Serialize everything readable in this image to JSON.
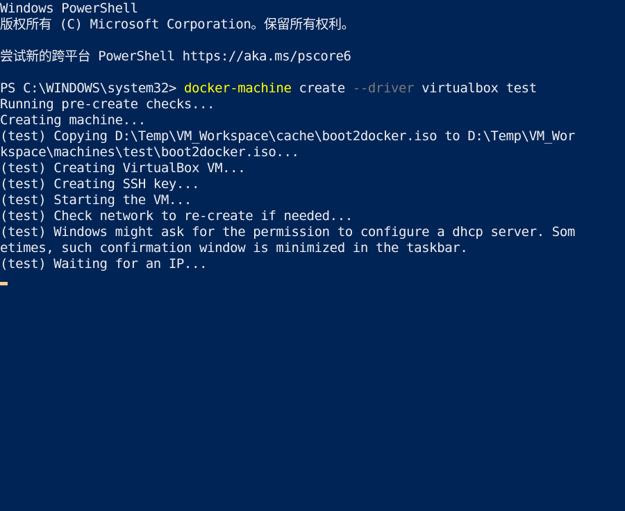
{
  "window": {
    "app": "Windows PowerShell"
  },
  "lines": {
    "l0": "Windows PowerShell",
    "l1": "版权所有 (C) Microsoft Corporation。保留所有权利。",
    "l2": "",
    "l3": "尝试新的跨平台 PowerShell https://aka.ms/pscore6",
    "l4": "",
    "l6": "Running pre-create checks...",
    "l7": "Creating machine...",
    "l8": "(test) Copying D:\\Temp\\VM_Workspace\\cache\\boot2docker.iso to D:\\Temp\\VM_Wor",
    "l9": "kspace\\machines\\test\\boot2docker.iso...",
    "l10": "(test) Creating VirtualBox VM...",
    "l11": "(test) Creating SSH key...",
    "l12": "(test) Starting the VM...",
    "l13": "(test) Check network to re-create if needed...",
    "l14": "(test) Windows might ask for the permission to configure a dhcp server. Som",
    "l15": "etimes, such confirmation window is minimized in the taskbar.",
    "l16": "(test) Waiting for an IP..."
  },
  "prompt": {
    "path": "PS C:\\WINDOWS\\system32> ",
    "command": "docker-machine",
    "arg1": " create ",
    "param": "--driver",
    "arg2": " virtualbox test"
  },
  "colors": {
    "background": "#012456",
    "foreground": "#eeedf0",
    "command": "#ffff00",
    "parameter": "#7a7a7a",
    "cursor": "#fecd8c"
  }
}
